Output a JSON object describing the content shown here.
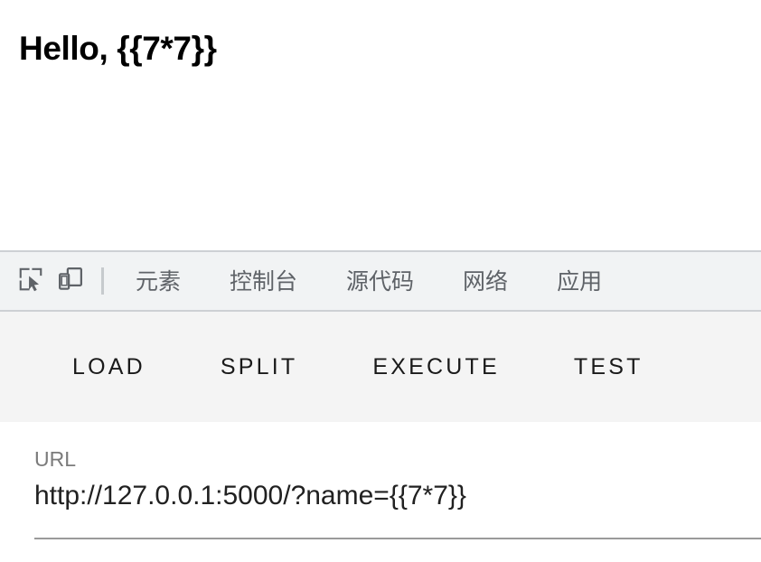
{
  "page": {
    "heading": "Hello, {{7*7}}"
  },
  "devtools": {
    "icons": [
      {
        "name": "inspect-element-icon",
        "title": "inspect element"
      },
      {
        "name": "device-toolbar-icon",
        "title": "toggle device toolbar"
      }
    ],
    "tabs": [
      {
        "label": "元素"
      },
      {
        "label": "控制台"
      },
      {
        "label": "源代码"
      },
      {
        "label": "网络"
      },
      {
        "label": "应用"
      }
    ]
  },
  "actions": {
    "buttons": [
      {
        "label": "LOAD"
      },
      {
        "label": "SPLIT"
      },
      {
        "label": "EXECUTE"
      },
      {
        "label": "TEST"
      }
    ]
  },
  "form": {
    "url_field": {
      "label": "URL",
      "value": "http://127.0.0.1:5000/?name={{7*7}}",
      "placeholder": "URL"
    }
  },
  "colors": {
    "toolbar_background": "#f1f3f4",
    "action_bar_background": "#f4f4f4",
    "divider": "#cdd0d4",
    "tab_text": "#5f6368",
    "label_text": "#7b7b7b",
    "value_text": "#212121",
    "underline": "#9a9a9a"
  }
}
